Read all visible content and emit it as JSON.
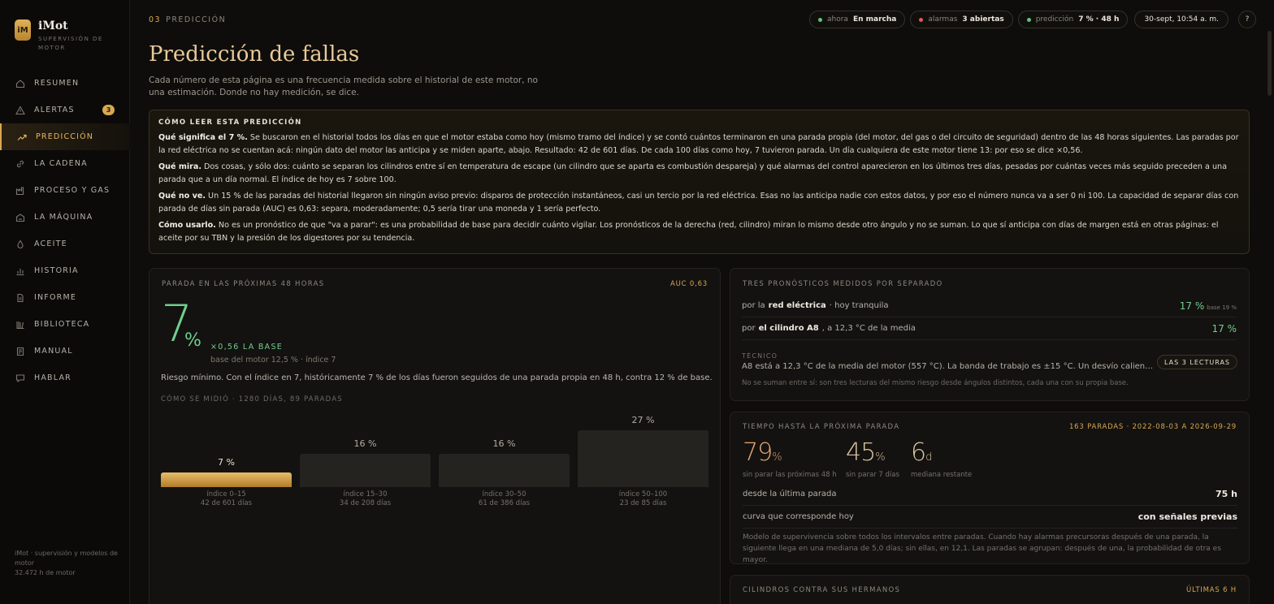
{
  "brand": {
    "logo": "iM",
    "title": "iMot",
    "subtitle": "SUPERVISIÓN DE MOTOR"
  },
  "nav": [
    {
      "label": "RESUMEN",
      "icon": "home-icon"
    },
    {
      "label": "ALERTAS",
      "icon": "warning-icon",
      "badge": "3"
    },
    {
      "label": "PREDICCIÓN",
      "icon": "trend-icon",
      "active": true
    },
    {
      "label": "LA CADENA",
      "icon": "link-icon"
    },
    {
      "label": "PROCESO Y GAS",
      "icon": "factory-icon"
    },
    {
      "label": "LA MÁQUINA",
      "icon": "machine-icon"
    },
    {
      "label": "ACEITE",
      "icon": "drop-icon"
    },
    {
      "label": "HISTORIA",
      "icon": "bars-icon"
    },
    {
      "label": "INFORME",
      "icon": "document-icon"
    },
    {
      "label": "BIBLIOTECA",
      "icon": "library-icon"
    },
    {
      "label": "MANUAL",
      "icon": "book-icon"
    },
    {
      "label": "HABLAR",
      "icon": "chat-icon"
    }
  ],
  "sidebar_foot": {
    "line1": "iMot · supervisión y modelos de motor",
    "line2": "32.472 h de motor"
  },
  "header": {
    "crumb_num": "03",
    "crumb_label": "PREDICCIÓN",
    "pills": [
      {
        "label": "ahora",
        "value": "En marcha",
        "dot": "#5fc27e"
      },
      {
        "label": "alarmas",
        "value": "3 abiertas",
        "dot": "#e0585c"
      },
      {
        "label": "predicción",
        "value": "7 % · 48 h",
        "dot": "#5fc27e"
      }
    ],
    "date": "30-sept, 10:54 a. m.",
    "help": "?"
  },
  "page": {
    "title": "Predicción de fallas",
    "subtitle": "Cada número de esta página es una frecuencia medida sobre el historial de este motor, no una estimación. Donde no hay medición, se dice."
  },
  "explain": {
    "heading": "CÓMO LEER ESTA PREDICCIÓN",
    "p1_b": "Qué significa el 7 %.",
    "p1": " Se buscaron en el historial todos los días en que el motor estaba como hoy (mismo tramo del índice) y se contó cuántos terminaron en una parada propia (del motor, del gas o del circuito de seguridad) dentro de las 48 horas siguientes. Las paradas por la red eléctrica no se cuentan acá: ningún dato del motor las anticipa y se miden aparte, abajo. Resultado: 42 de 601 días. De cada 100 días como hoy, 7 tuvieron parada. Un día cualquiera de este motor tiene 13: por eso se dice ×0,56.",
    "p2_b": "Qué mira.",
    "p2": " Dos cosas, y sólo dos: cuánto se separan los cilindros entre sí en temperatura de escape (un cilindro que se aparta es combustión despareja) y qué alarmas del control aparecieron en los últimos tres días, pesadas por cuántas veces más seguido preceden a una parada que a un día normal. El índice de hoy es 7 sobre 100.",
    "p3_b": "Qué no ve.",
    "p3": " Un 15 % de las paradas del historial llegaron sin ningún aviso previo: disparos de protección instantáneos, casi un tercio por la red eléctrica. Esas no las anticipa nadie con estos datos, y por eso el número nunca va a ser 0 ni 100. La capacidad de separar días con parada de días sin parada (AUC) es 0,63: separa, moderadamente; 0,5 sería tirar una moneda y 1 sería perfecto.",
    "p4_b": "Cómo usarlo.",
    "p4": " No es un pronóstico de que \"va a parar\": es una probabilidad de base para decidir cuánto vigilar. Los pronósticos de la derecha (red, cilindro) miran lo mismo desde otro ángulo y no se suman. Lo que sí anticipa con días de margen está en otras páginas: el aceite por su TBN y la presión de los digestores por su tendencia."
  },
  "left": {
    "heading": "PARADA EN LAS PRÓXIMAS 48 HORAS",
    "meta": "AUC 0,63",
    "big": "7",
    "big_unit": "%",
    "mult": "×0,56 LA BASE",
    "base": "base del motor 12,5 % · índice 7",
    "risk": "Riesgo mínimo. Con el índice en 7, históricamente 7 % de los días fueron seguidos de una parada propia en 48 h, contra 12 % de base.",
    "medido": "CÓMO SE MIDIÓ · 1280 DÍAS, 89 PARADAS"
  },
  "chart_data": {
    "type": "bar",
    "categories": [
      "índice 0–15",
      "índice 15–30",
      "índice 30–50",
      "índice 50–100"
    ],
    "values": [
      7,
      16,
      16,
      27
    ],
    "value_labels": [
      "7 %",
      "16 %",
      "16 %",
      "27 %"
    ],
    "sublabels": [
      "42 de 601 días",
      "34 de 208 días",
      "61 de 386 días",
      "23 de 85 días"
    ],
    "highlight_index": 0,
    "ylim": [
      0,
      27
    ]
  },
  "right_top": {
    "heading": "TRES PRONÓSTICOS MEDIDOS POR SEPARADO",
    "row1": {
      "pre": "por la",
      "bold": "red eléctrica",
      "post": "· hoy tranquila",
      "value": "17 %",
      "small": "base 19 %"
    },
    "row2": {
      "pre": "por",
      "bold": "el cilindro A8",
      "post": ", a 12,3 °C de la media",
      "value": "17 %"
    },
    "tech_label": "TÉCNICO",
    "tech_text": "A8 está a 12,3 °C de la media del motor (557 °C). La banda de trabajo es ±15 °C. Un desvío caliente sostenido...",
    "tech_btn": "LAS 3 LECTURAS",
    "note": "No se suman entre sí: son tres lecturas del mismo riesgo desde ángulos distintos, cada una con su propia base."
  },
  "right_mid": {
    "heading": "TIEMPO HASTA LA PRÓXIMA PARADA",
    "meta": "163 PARADAS · 2022-08-03 A 2026-09-29",
    "s1": {
      "value": "79",
      "unit": "%",
      "label": "sin parar las próximas 48 h"
    },
    "s2": {
      "value": "45",
      "unit": "%",
      "label": "sin parar 7 días"
    },
    "s3": {
      "value": "6",
      "unit": "d",
      "label": "mediana restante"
    },
    "row1": {
      "label": "desde la última parada",
      "value": "75 h"
    },
    "row2": {
      "label": "curva que corresponde hoy",
      "value": "con señales previas"
    },
    "note": "Modelo de supervivencia sobre todos los intervalos entre paradas. Cuando hay alarmas precursoras después de una parada, la siguiente llega en una mediana de 5,0 días; sin ellas, en 12,1. Las paradas se agrupan: después de una, la probabilidad de otra es mayor."
  },
  "right_bot": {
    "heading": "CILINDROS CONTRA SUS HERMANOS",
    "meta": "ÚLTIMAS 6 H"
  }
}
